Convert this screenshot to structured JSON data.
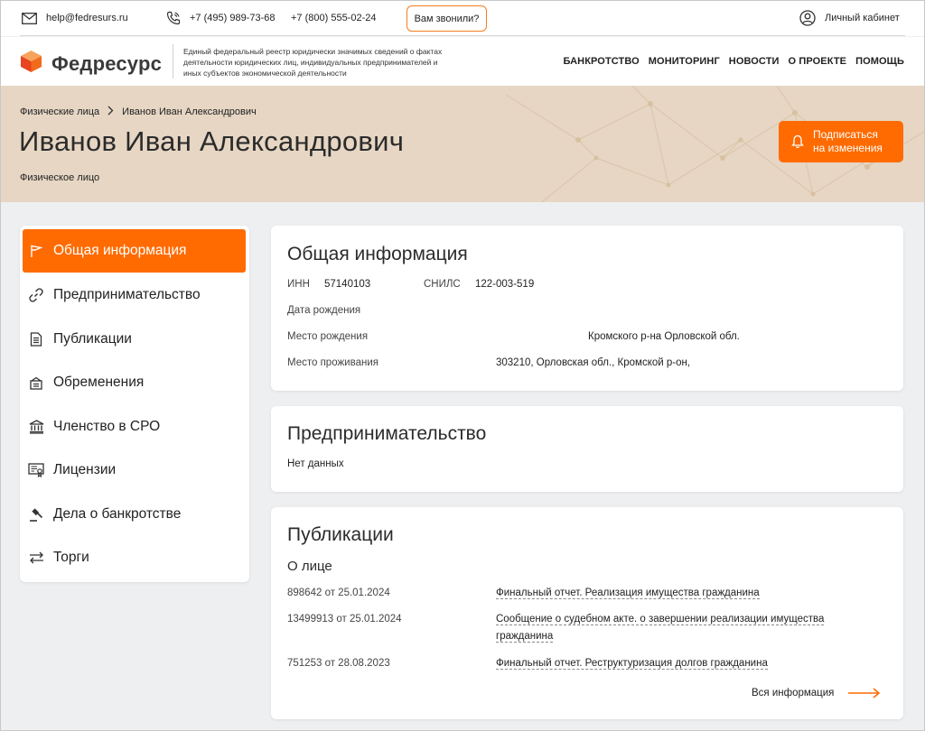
{
  "topbar": {
    "email": "help@fedresurs.ru",
    "phone1": "+7 (495) 989-73-68",
    "phone2": "+7 (800) 555-02-24",
    "callback_label": "Вам звонили?",
    "account_label": "Личный кабинет",
    "icons": [
      "mail-icon",
      "phone-icon",
      "user-icon"
    ]
  },
  "header": {
    "logo_name": "Федресурс",
    "logo_description": "Единый федеральный реестр юридически значимых сведений о фактах деятельности юридических лиц, индивидуальных предпринимателей и иных субъектов экономической деятельности",
    "nav": [
      "БАНКРОТСТВО",
      "МОНИТОРИНГ",
      "НОВОСТИ",
      "О ПРОЕКТЕ",
      "ПОМОЩЬ"
    ]
  },
  "hero": {
    "breadcrumb": [
      "Физические лица",
      "Иванов Иван Александрович"
    ],
    "title": "Иванов Иван Александрович",
    "subtitle": "Физическое лицо",
    "subscribe_line1": "Подписаться",
    "subscribe_line2": "на изменения"
  },
  "sidebar": {
    "items": [
      {
        "label": "Общая информация",
        "icon": "flag-icon",
        "active": true
      },
      {
        "label": "Предпринимательство",
        "icon": "link-icon",
        "active": false
      },
      {
        "label": "Публикации",
        "icon": "document-icon",
        "active": false
      },
      {
        "label": "Обременения",
        "icon": "archive-icon",
        "active": false
      },
      {
        "label": "Членство в СРО",
        "icon": "bank-icon",
        "active": false
      },
      {
        "label": "Лицензии",
        "icon": "certificate-icon",
        "active": false
      },
      {
        "label": "Дела о банкротстве",
        "icon": "gavel-icon",
        "active": false
      },
      {
        "label": "Торги",
        "icon": "exchange-icon",
        "active": false
      }
    ]
  },
  "general": {
    "title": "Общая информация",
    "inn_label": "ИНН",
    "inn_value": "57140103",
    "snils_label": "СНИЛС",
    "snils_value": "122-003-519",
    "birth_date_label": "Дата рождения",
    "birth_place_label": "Место рождения",
    "birth_place_value": "Кромского р-на Орловской обл.",
    "residence_label": "Место проживания",
    "residence_value": "303210, Орловская обл., Кромской р-он,"
  },
  "business": {
    "title": "Предпринимательство",
    "empty": "Нет данных"
  },
  "publications": {
    "title": "Публикации",
    "subtitle": "О лице",
    "items": [
      {
        "id": "898642 от 25.01.2024",
        "line1": "Финальный отчет. Реализация имущества гражданина",
        "line2": ""
      },
      {
        "id": "13499913 от 25.01.2024",
        "line1": "Сообщение о судебном акте. о завершении реализации имущества",
        "line2": "гражданина"
      },
      {
        "id": "751253 от 28.08.2023",
        "line1": "Финальный отчет. Реструктуризация долгов гражданина",
        "line2": ""
      }
    ],
    "all_info": "Вся информация"
  },
  "colors": {
    "accent": "#ff6b00",
    "hero_bg": "#e6d6c3",
    "page_bg": "#eeeff1"
  }
}
